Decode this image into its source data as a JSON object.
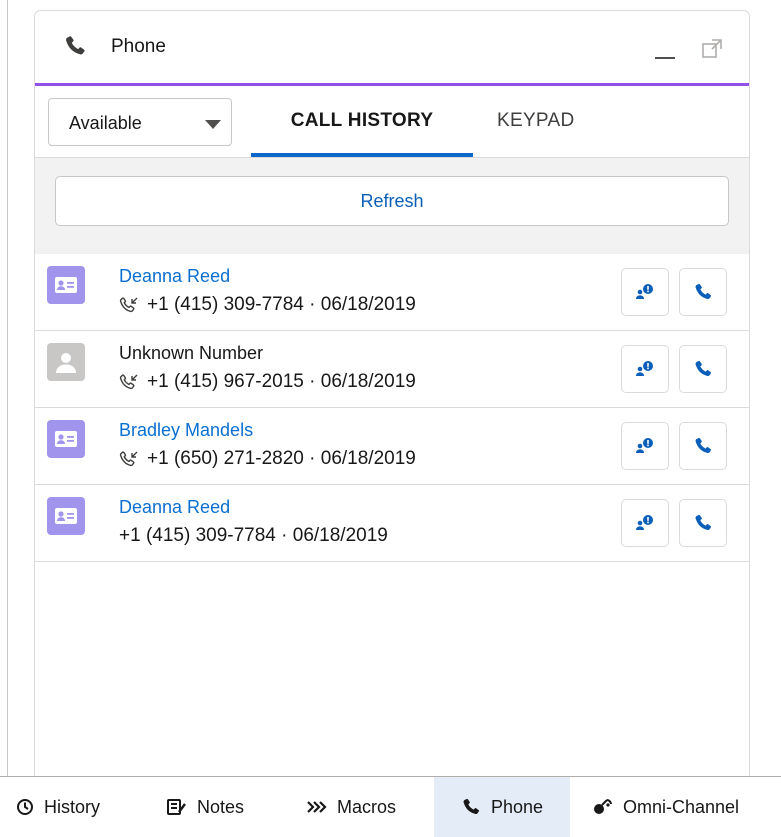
{
  "panel": {
    "title": "Phone",
    "status_value": "Available",
    "tabs": [
      {
        "label": "CALL HISTORY",
        "active": true
      },
      {
        "label": "KEYPAD",
        "active": false
      }
    ],
    "refresh_label": "Refresh",
    "calls": [
      {
        "name": "Deanna Reed",
        "is_contact": true,
        "detail": "+1 (415) 309-7784 · 06/18/2019",
        "call_icon": true
      },
      {
        "name": "Unknown Number",
        "is_contact": false,
        "detail": "+1 (415) 967-2015 · 06/18/2019",
        "call_icon": true
      },
      {
        "name": "Bradley Mandels",
        "is_contact": true,
        "detail": "+1 (650) 271-2820 · 06/18/2019",
        "call_icon": true
      },
      {
        "name": "Deanna Reed",
        "is_contact": true,
        "detail": "+1 (415) 309-7784 · 06/18/2019",
        "call_icon": false
      }
    ]
  },
  "utility_bar": {
    "items": [
      {
        "label": "History",
        "icon": "clock-icon",
        "active": false
      },
      {
        "label": "Notes",
        "icon": "notes-icon",
        "active": false
      },
      {
        "label": "Macros",
        "icon": "macros-icon",
        "active": false
      },
      {
        "label": "Phone",
        "icon": "phone-icon",
        "active": true
      },
      {
        "label": "Omni-Channel",
        "icon": "omni-channel-icon",
        "active": false
      }
    ]
  },
  "colors": {
    "accent_purple": "#9050e9",
    "link_blue": "#0b6fd0",
    "tab_underline": "#0b67c9",
    "contact_avatar": "#a094ed",
    "unknown_avatar": "#c9c7c5",
    "active_util_bg": "#e3ecf7"
  }
}
